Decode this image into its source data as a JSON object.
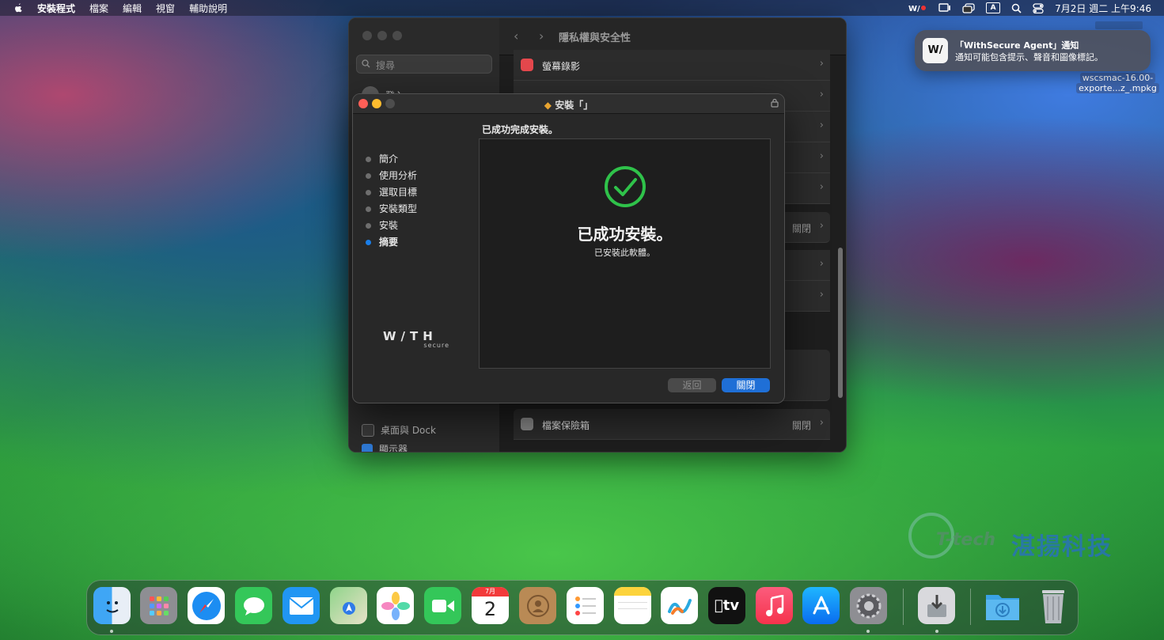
{
  "menubar": {
    "app": "安裝程式",
    "items": [
      "檔案",
      "編輯",
      "視窗",
      "輔助說明"
    ],
    "clock": "7月2日 週二 上午9:46",
    "input_badge": "A"
  },
  "settings": {
    "title": "隱私權與安全性",
    "search_placeholder": "搜尋",
    "sidebar_items": [
      "登入",
      "桌面與 Dock",
      "顯示器"
    ],
    "rows": [
      {
        "label": "螢幕錄影",
        "status": ""
      },
      {
        "label": "檔案保險箱",
        "status": "關閉"
      }
    ],
    "row_status_mid": "關閉"
  },
  "installer": {
    "title": "安裝「」",
    "heading": "已成功完成安裝。",
    "steps": [
      "簡介",
      "使用分析",
      "選取目標",
      "安裝類型",
      "安裝",
      "摘要"
    ],
    "active_step": 5,
    "success_title": "已成功安裝。",
    "success_sub": "已安裝此軟體。",
    "back_label": "返回",
    "close_label": "關閉",
    "logo_text": "W/TH",
    "logo_sub": "secure"
  },
  "notification": {
    "app_glyph": "W/",
    "title": "「WithSecure Agent」通知",
    "body": "通知可能包含提示、聲音和圖像標記。"
  },
  "desktop_file": {
    "line1": "wscsmac-16.00-",
    "line2": "exporte...z_.mpkg"
  },
  "watermark": {
    "brand": "T-tech",
    "name": "湛揚科技"
  },
  "dock": {
    "calendar_month": "7月",
    "calendar_day": "2",
    "tv_label": "tv"
  },
  "colors": {
    "accent": "#1f6fd6",
    "success": "#2fc24a"
  }
}
